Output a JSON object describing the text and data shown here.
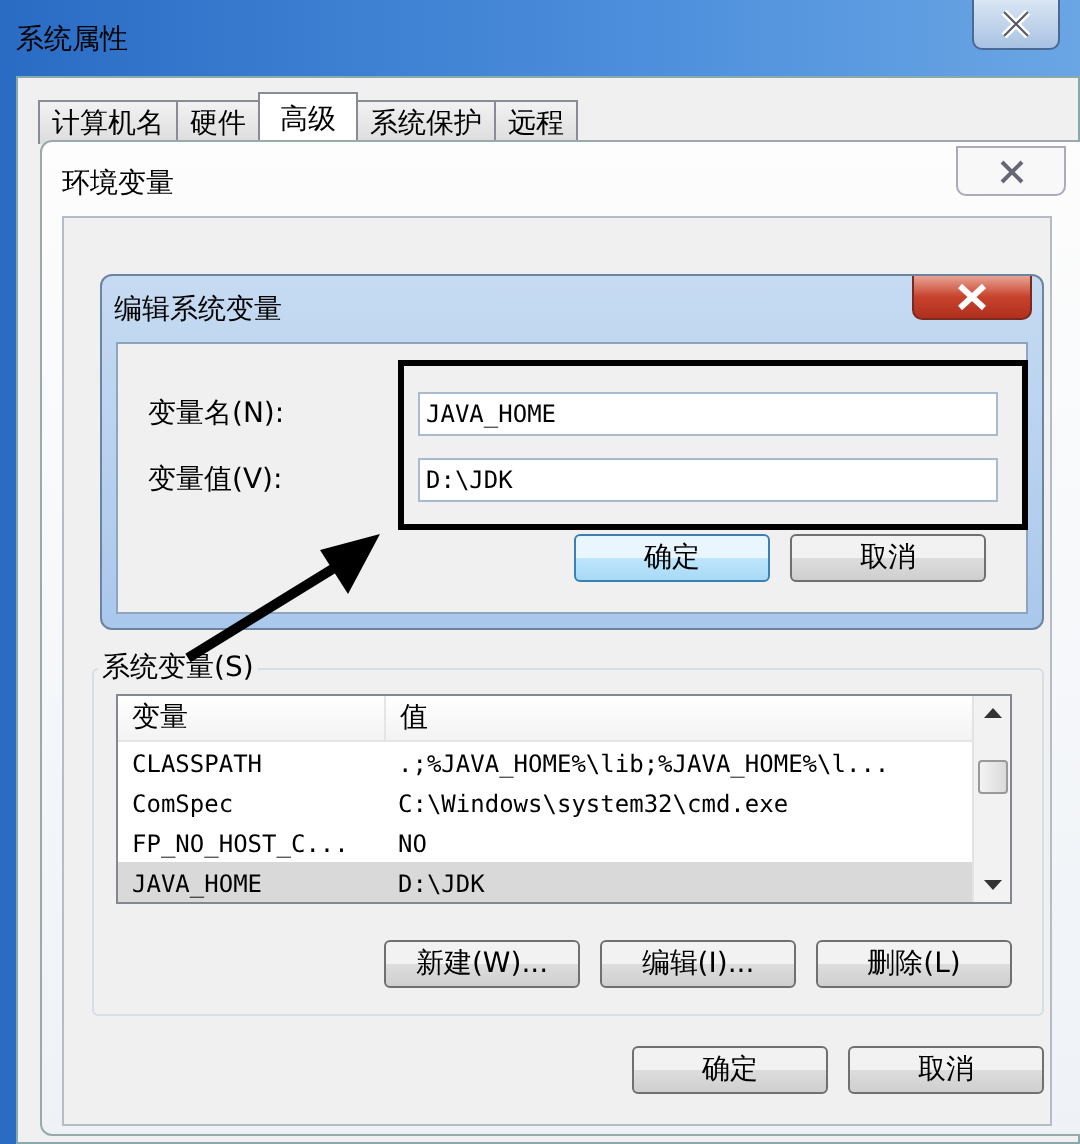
{
  "system_properties": {
    "title": "系统属性",
    "tabs": [
      {
        "label": "计算机名",
        "selected": false
      },
      {
        "label": "硬件",
        "selected": false
      },
      {
        "label": "高级",
        "selected": true
      },
      {
        "label": "系统保护",
        "selected": false
      },
      {
        "label": "远程",
        "selected": false
      }
    ]
  },
  "environment_variables": {
    "title": "环境变量",
    "system_variables": {
      "label": "系统变量(S)",
      "columns": [
        "变量",
        "值"
      ],
      "rows": [
        {
          "name": "CLASSPATH",
          "value": ".;%JAVA_HOME%\\lib;%JAVA_HOME%\\l...",
          "selected": false
        },
        {
          "name": "ComSpec",
          "value": "C:\\Windows\\system32\\cmd.exe",
          "selected": false
        },
        {
          "name": "FP_NO_HOST_C...",
          "value": "NO",
          "selected": false
        },
        {
          "name": "JAVA_HOME",
          "value": "D:\\JDK",
          "selected": true
        }
      ],
      "buttons": [
        "新建(W)...",
        "编辑(I)...",
        "删除(L)"
      ]
    },
    "buttons": [
      "确定",
      "取消"
    ]
  },
  "edit_dialog": {
    "title": "编辑系统变量",
    "fields": [
      {
        "label": "变量名(N):",
        "value": "JAVA_HOME"
      },
      {
        "label": "变量值(V):",
        "value": "D:\\JDK"
      }
    ],
    "buttons": [
      {
        "label": "确定",
        "selected": true
      },
      {
        "label": "取消",
        "selected": false
      }
    ]
  }
}
